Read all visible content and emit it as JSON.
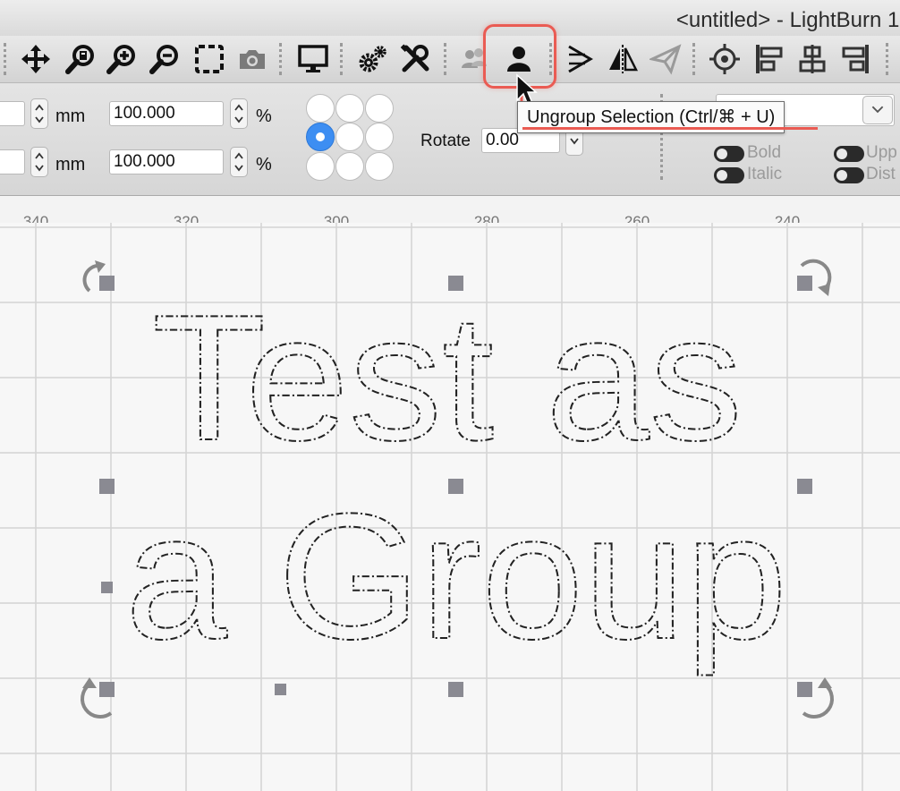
{
  "window": {
    "title": "<untitled> - LightBurn 1."
  },
  "toolbar": {
    "buttons": [
      {
        "name": "move-button",
        "icon": "move-arrows-icon"
      },
      {
        "name": "zoom-to-page-button",
        "icon": "zoom-page-icon"
      },
      {
        "name": "zoom-in-button",
        "icon": "zoom-in-icon"
      },
      {
        "name": "zoom-out-button",
        "icon": "zoom-out-icon"
      },
      {
        "name": "frame-selection-button",
        "icon": "dashed-square-icon"
      },
      {
        "name": "camera-button",
        "icon": "camera-icon"
      },
      {
        "name": "devices-button",
        "icon": "monitor-icon"
      },
      {
        "name": "settings-button",
        "icon": "gears-icon"
      },
      {
        "name": "machine-settings-button",
        "icon": "tools-icon"
      },
      {
        "name": "group-button",
        "icon": "group-people-icon"
      },
      {
        "name": "ungroup-button",
        "icon": "person-icon"
      },
      {
        "name": "flip-horizontal-button",
        "icon": "flip-h-icon"
      },
      {
        "name": "mirror-button",
        "icon": "mirror-icon"
      },
      {
        "name": "send-button",
        "icon": "paper-plane-icon"
      },
      {
        "name": "target-button",
        "icon": "crosshair-icon"
      },
      {
        "name": "align-left-button",
        "icon": "align-left-icon"
      },
      {
        "name": "align-center-button",
        "icon": "align-center-icon"
      },
      {
        "name": "align-right-button",
        "icon": "align-right-icon"
      }
    ]
  },
  "tooltip": {
    "text": "Ungroup Selection (Ctrl/⌘ + U)"
  },
  "properties": {
    "width_unit": "mm",
    "height_unit": "mm",
    "width_scale": "100.000",
    "height_scale": "100.000",
    "scale_unit": "%",
    "rotate_label": "Rotate",
    "rotate_value": "0.00",
    "font_options": {
      "bold": "Bold",
      "italic": "Italic",
      "upper": "Upp",
      "distort": "Dist"
    }
  },
  "ruler": {
    "labels": [
      "340",
      "320",
      "300",
      "280",
      "260",
      "240"
    ]
  },
  "canvas": {
    "text_line_1": "Test as",
    "text_line_2": "a Group"
  },
  "colors": {
    "accent": "#3d8ef2",
    "highlight": "#ea5b53"
  }
}
